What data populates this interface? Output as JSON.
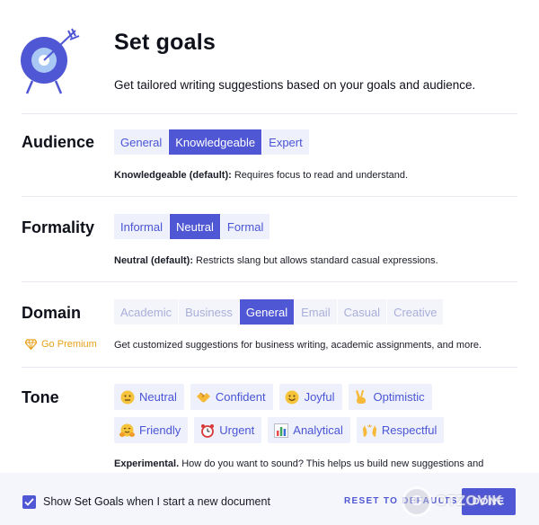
{
  "header": {
    "title": "Set goals",
    "subtitle": "Get tailored writing suggestions based on your goals and audience."
  },
  "audience": {
    "label": "Audience",
    "options": [
      "General",
      "Knowledgeable",
      "Expert"
    ],
    "selected": "Knowledgeable",
    "desc_strong": "Knowledgeable (default):",
    "desc_text": " Requires focus to read and understand."
  },
  "formality": {
    "label": "Formality",
    "options": [
      "Informal",
      "Neutral",
      "Formal"
    ],
    "selected": "Neutral",
    "desc_strong": "Neutral (default):",
    "desc_text": " Restricts slang but allows standard casual expressions."
  },
  "domain": {
    "label": "Domain",
    "premium": "Go Premium",
    "options": [
      "Academic",
      "Business",
      "General",
      "Email",
      "Casual",
      "Creative"
    ],
    "selected": "General",
    "desc_text": "Get customized suggestions for business writing, academic assignments, and more."
  },
  "tone": {
    "label": "Tone",
    "row1": [
      {
        "label": "Neutral",
        "icon": "neutral-face-icon"
      },
      {
        "label": "Confident",
        "icon": "handshake-icon"
      },
      {
        "label": "Joyful",
        "icon": "smiling-face-icon"
      },
      {
        "label": "Optimistic",
        "icon": "victory-hand-icon"
      }
    ],
    "row2": [
      {
        "label": "Friendly",
        "icon": "hugging-face-icon"
      },
      {
        "label": "Urgent",
        "icon": "alarm-clock-icon"
      },
      {
        "label": "Analytical",
        "icon": "bar-chart-icon"
      },
      {
        "label": "Respectful",
        "icon": "raised-hands-icon"
      }
    ],
    "desc_strong": "Experimental.",
    "desc_text": " How do you want to sound? This helps us build new suggestions and"
  },
  "footer": {
    "checkbox_pre": "Show ",
    "checkbox_strong": "Set Goals",
    "checkbox_post": " when I start a new document",
    "reset_label": "RESET TO DEFAULTS",
    "done_label": "DONE"
  },
  "watermark": {
    "text": "OTZOVIK"
  },
  "colors": {
    "accent": "#4f57d4",
    "chip_bg": "#eef0fb",
    "premium": "#e8a11a"
  }
}
